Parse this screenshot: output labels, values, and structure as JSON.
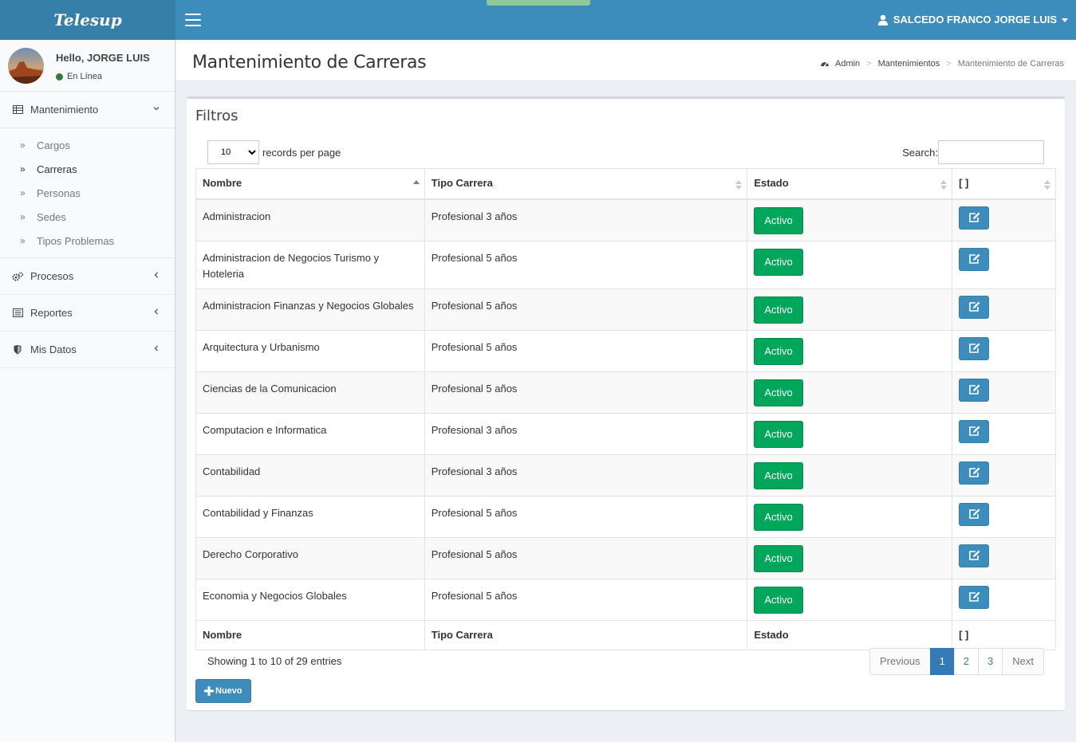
{
  "app": {
    "logo": "Telesup"
  },
  "header": {
    "user_name": "SALCEDO FRANCO JORGE LUIS"
  },
  "sidebar": {
    "greeting": "Hello, JORGE LUIS",
    "status": "En Línea",
    "sections": [
      {
        "label": "Mantenimiento",
        "icon": "table-icon",
        "expanded": true
      },
      {
        "label": "Procesos",
        "icon": "gears-icon",
        "expanded": false
      },
      {
        "label": "Reportes",
        "icon": "list-icon",
        "expanded": false
      },
      {
        "label": "Mis Datos",
        "icon": "shield-icon",
        "expanded": false
      }
    ],
    "submenu": [
      "Cargos",
      "Carreras",
      "Personas",
      "Sedes",
      "Tipos Problemas"
    ],
    "active_submenu": "Carreras"
  },
  "page": {
    "title": "Mantenimiento de Carreras",
    "breadcrumb": [
      "Admin",
      "Mantenimientos",
      "Mantenimiento de Carreras"
    ]
  },
  "box": {
    "title": "Filtros"
  },
  "table_controls": {
    "page_length": "10",
    "length_label": "records per page",
    "search_label": "Search:",
    "search_value": ""
  },
  "table": {
    "columns": [
      "Nombre",
      "Tipo Carrera",
      "Estado",
      "[ ]"
    ],
    "rows": [
      {
        "nombre": "Administracion",
        "tipo": "Profesional 3 años",
        "estado": "Activo"
      },
      {
        "nombre": "Administracion de Negocios Turismo y Hoteleria",
        "tipo": "Profesional 5 años",
        "estado": "Activo"
      },
      {
        "nombre": "Administracion Finanzas y Negocios Globales",
        "tipo": "Profesional 5 años",
        "estado": "Activo"
      },
      {
        "nombre": "Arquitectura y Urbanismo",
        "tipo": "Profesional 5 años",
        "estado": "Activo"
      },
      {
        "nombre": "Ciencias de la Comunicacion",
        "tipo": "Profesional 5 años",
        "estado": "Activo"
      },
      {
        "nombre": "Computacion e Informatica",
        "tipo": "Profesional 3 años",
        "estado": "Activo"
      },
      {
        "nombre": "Contabilidad",
        "tipo": "Profesional 3 años",
        "estado": "Activo"
      },
      {
        "nombre": "Contabilidad y Finanzas",
        "tipo": "Profesional 5 años",
        "estado": "Activo"
      },
      {
        "nombre": "Derecho Corporativo",
        "tipo": "Profesional 5 años",
        "estado": "Activo"
      },
      {
        "nombre": "Economia y Negocios Globales",
        "tipo": "Profesional 5 años",
        "estado": "Activo"
      }
    ]
  },
  "footer_info": "Showing 1 to 10 of 29 entries",
  "pagination": {
    "previous": "Previous",
    "pages": [
      "1",
      "2",
      "3"
    ],
    "current": "1",
    "next": "Next"
  },
  "new_button": "Nuevo",
  "colors": {
    "header": "#3c8dbc",
    "logo_bg": "#367fa9",
    "success": "#00a65a",
    "primary": "#3c8dbc"
  }
}
